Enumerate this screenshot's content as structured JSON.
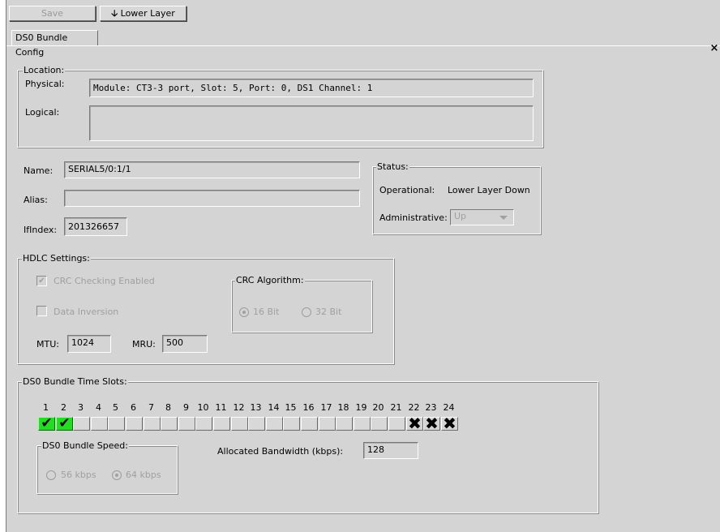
{
  "toolbar": {
    "save_label": "Save",
    "lower_layer_label": "Lower Layer"
  },
  "tab": {
    "label": "DS0 Bundle Config"
  },
  "close_glyph": "×",
  "location": {
    "legend": "Location:",
    "physical_label": "Physical:",
    "physical_value": "Module: CT3-3 port, Slot: 5, Port: 0, DS1 Channel: 1",
    "logical_label": "Logical:",
    "logical_value": ""
  },
  "identity": {
    "name_label": "Name:",
    "name_value": "SERIAL5/0:1/1",
    "alias_label": "Alias:",
    "alias_value": "",
    "ifindex_label": "IfIndex:",
    "ifindex_value": "201326657"
  },
  "status": {
    "legend": "Status:",
    "operational_label": "Operational:",
    "operational_value": "Lower Layer Down",
    "administrative_label": "Administrative:",
    "administrative_value": "Up"
  },
  "hdlc": {
    "legend": "HDLC Settings:",
    "crc_checking_label": "CRC Checking Enabled",
    "crc_checking_checked": true,
    "data_inversion_label": "Data Inversion",
    "data_inversion_checked": false,
    "crc_algorithm_legend": "CRC Algorithm:",
    "crc16_label": "16 Bit",
    "crc32_label": "32 Bit",
    "crc_selected": "16 Bit",
    "mtu_label": "MTU:",
    "mtu_value": "1024",
    "mru_label": "MRU:",
    "mru_value": "500"
  },
  "timeslots": {
    "legend": "DS0 Bundle Time Slots:",
    "slots": [
      {
        "n": "1",
        "state": "selected"
      },
      {
        "n": "2",
        "state": "selected"
      },
      {
        "n": "3",
        "state": "empty"
      },
      {
        "n": "4",
        "state": "empty"
      },
      {
        "n": "5",
        "state": "empty"
      },
      {
        "n": "6",
        "state": "empty"
      },
      {
        "n": "7",
        "state": "empty"
      },
      {
        "n": "8",
        "state": "empty"
      },
      {
        "n": "9",
        "state": "empty"
      },
      {
        "n": "10",
        "state": "empty"
      },
      {
        "n": "11",
        "state": "empty"
      },
      {
        "n": "12",
        "state": "empty"
      },
      {
        "n": "13",
        "state": "empty"
      },
      {
        "n": "14",
        "state": "empty"
      },
      {
        "n": "15",
        "state": "empty"
      },
      {
        "n": "16",
        "state": "empty"
      },
      {
        "n": "17",
        "state": "empty"
      },
      {
        "n": "18",
        "state": "empty"
      },
      {
        "n": "19",
        "state": "empty"
      },
      {
        "n": "20",
        "state": "empty"
      },
      {
        "n": "21",
        "state": "empty"
      },
      {
        "n": "22",
        "state": "unavailable"
      },
      {
        "n": "23",
        "state": "unavailable"
      },
      {
        "n": "24",
        "state": "unavailable"
      }
    ],
    "speed_legend": "DS0 Bundle Speed:",
    "speed56_label": "56 kbps",
    "speed64_label": "64 kbps",
    "speed_selected": "64 kbps",
    "bandwidth_label": "Allocated Bandwidth (kbps):",
    "bandwidth_value": "128"
  },
  "colors": {
    "selected_slot": "#22dd22",
    "panel": "#d4d4d4"
  },
  "icons": {
    "lower_layer": "down-arrow-icon",
    "selected": "checkmark-icon",
    "unavailable": "x-mark-icon"
  }
}
